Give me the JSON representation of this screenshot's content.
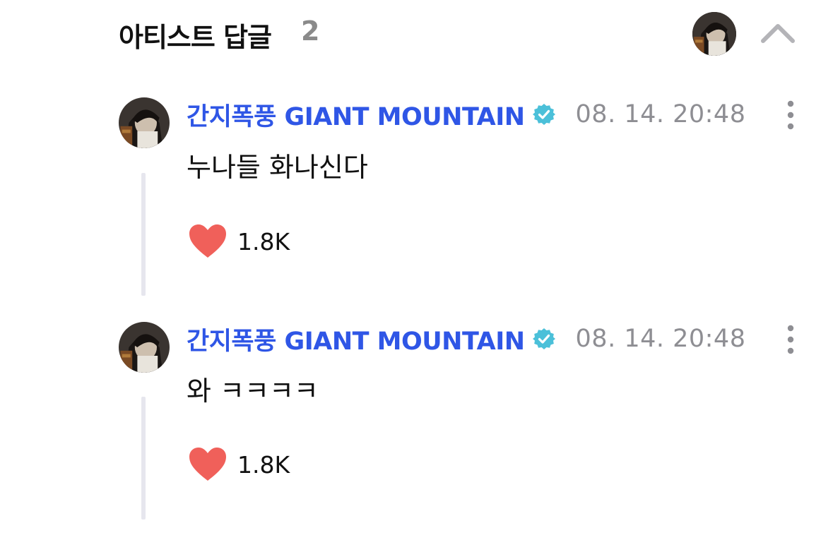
{
  "header": {
    "title": "아티스트 답글",
    "count": "2",
    "avatar_icon": "artist-avatar-icon",
    "collapse_icon": "chevron-up-icon"
  },
  "colors": {
    "author_blue": "#2f56e6",
    "verified_teal": "#4bc0d9",
    "heart_red": "#f0605a",
    "muted_gray": "#8e8e93",
    "thread_line": "#e6e6ee"
  },
  "replies": [
    {
      "author": "간지폭풍 GIANT MOUNTAIN",
      "verified_icon": "verified-badge-icon",
      "timestamp": "08. 14. 20:48",
      "text": "누나들 화나신다",
      "likes": "1.8K",
      "like_icon": "heart-icon",
      "more_icon": "more-vertical-icon"
    },
    {
      "author": "간지폭풍 GIANT MOUNTAIN",
      "verified_icon": "verified-badge-icon",
      "timestamp": "08. 14. 20:48",
      "text": "와 ㅋㅋㅋㅋ",
      "likes": "1.8K",
      "like_icon": "heart-icon",
      "more_icon": "more-vertical-icon"
    }
  ]
}
